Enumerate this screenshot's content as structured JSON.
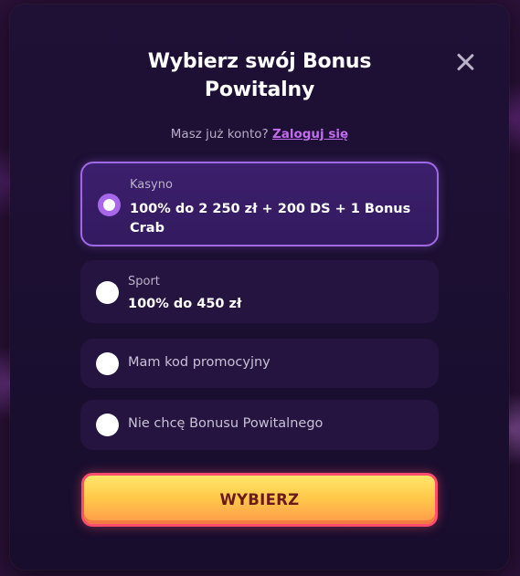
{
  "modal": {
    "title": "Wybierz swój Bonus Powitalny",
    "close_icon": "close-icon"
  },
  "login": {
    "prompt": "Masz już konto?",
    "link": "Zaloguj się"
  },
  "options": [
    {
      "category": "Kasyno",
      "label": "100% do 2 250 zł + 200 DS + 1 Bonus Crab",
      "selected": true
    },
    {
      "category": "Sport",
      "label": "100% do 450 zł",
      "selected": false
    },
    {
      "category": "",
      "label": "Mam kod promocyjny",
      "selected": false
    },
    {
      "category": "",
      "label": "Nie chcę Bonusu Powitalnego",
      "selected": false
    }
  ],
  "cta": {
    "label": "WYBIERZ"
  },
  "colors": {
    "accent": "#9f69e6",
    "link": "#c46cf0",
    "cta_gradient_top": "#ffe76a",
    "cta_border": "#ff4d6d"
  }
}
